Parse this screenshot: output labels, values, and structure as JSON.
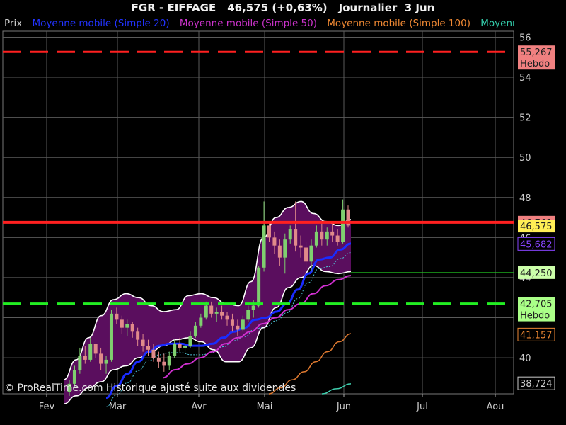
{
  "header": {
    "symbol": "FGR - EIFFAGE",
    "price_change": "46,575 (+0,63%)",
    "period": "Journalier  3 Jun"
  },
  "legend": [
    {
      "label": "Prix",
      "color": "#cccccc"
    },
    {
      "label": "Moyenne mobile (Simple 20)",
      "color": "#2233ff"
    },
    {
      "label": "Moyenne mobile (Simple 50)",
      "color": "#cc33cc"
    },
    {
      "label": "Moyenne mobile (Simple 100)",
      "color": "#ee8833"
    },
    {
      "label": "Moyenne mobile",
      "color": "#33ccaa"
    }
  ],
  "copyright": "© ProRealTime.com Historique ajusté suite aux dividendes",
  "colors": {
    "background": "#000000",
    "grid": "#5a5a5a",
    "band_fill": "#5a0e5e",
    "band_edge": "#ffffff",
    "up_candle": "#7fcf6f",
    "down_candle": "#e08a8a",
    "resistance": "#ff2020",
    "support": "#22ee22"
  },
  "chart_data": {
    "type": "candlestick",
    "x_ticks": [
      "Fev",
      "Mar",
      "Avr",
      "Mai",
      "Jun",
      "Jul",
      "Aou"
    ],
    "y_ticks": [
      40,
      42,
      44,
      46,
      48,
      50,
      52,
      54,
      56
    ],
    "ylim": [
      38.2,
      56.3
    ],
    "grid": true,
    "candles": [
      [
        38.3,
        38.9,
        38.1,
        38.7
      ],
      [
        38.7,
        39.6,
        38.6,
        39.4
      ],
      [
        39.4,
        40.5,
        39.2,
        40.1
      ],
      [
        40.1,
        40.6,
        39.7,
        39.9
      ],
      [
        39.9,
        41.0,
        39.8,
        40.7
      ],
      [
        40.7,
        40.6,
        40.0,
        40.2
      ],
      [
        40.2,
        40.5,
        39.4,
        39.7
      ],
      [
        39.7,
        40.1,
        39.2,
        39.9
      ],
      [
        39.9,
        42.4,
        39.8,
        42.2
      ],
      [
        42.2,
        42.5,
        41.7,
        41.9
      ],
      [
        41.9,
        42.1,
        41.2,
        41.5
      ],
      [
        41.5,
        41.9,
        41.1,
        41.7
      ],
      [
        41.7,
        41.8,
        41.0,
        41.3
      ],
      [
        41.3,
        41.5,
        40.6,
        40.9
      ],
      [
        40.9,
        41.2,
        40.3,
        40.6
      ],
      [
        40.6,
        40.9,
        40.1,
        40.4
      ],
      [
        40.4,
        40.7,
        39.8,
        40.0
      ],
      [
        40.0,
        40.3,
        39.5,
        39.8
      ],
      [
        39.8,
        40.2,
        39.3,
        39.6
      ],
      [
        39.6,
        40.3,
        39.4,
        40.1
      ],
      [
        40.1,
        40.9,
        40.0,
        40.7
      ],
      [
        40.7,
        41.0,
        40.3,
        40.5
      ],
      [
        40.5,
        40.8,
        40.2,
        40.6
      ],
      [
        40.6,
        41.3,
        40.5,
        41.1
      ],
      [
        41.1,
        41.8,
        41.0,
        41.6
      ],
      [
        41.6,
        42.2,
        41.5,
        42.0
      ],
      [
        42.0,
        42.8,
        41.9,
        42.6
      ],
      [
        42.6,
        42.8,
        42.0,
        42.2
      ],
      [
        42.2,
        42.5,
        41.8,
        42.3
      ],
      [
        42.3,
        42.6,
        41.9,
        42.1
      ],
      [
        42.1,
        42.3,
        41.6,
        41.9
      ],
      [
        41.9,
        42.2,
        41.3,
        41.6
      ],
      [
        41.6,
        41.9,
        41.1,
        41.4
      ],
      [
        41.4,
        42.1,
        41.3,
        41.9
      ],
      [
        41.9,
        42.6,
        41.8,
        42.4
      ],
      [
        42.4,
        42.9,
        42.0,
        42.6
      ],
      [
        42.6,
        44.6,
        42.5,
        44.5
      ],
      [
        44.5,
        47.8,
        44.3,
        46.6
      ],
      [
        46.6,
        46.8,
        45.8,
        46.0
      ],
      [
        46.0,
        46.3,
        45.2,
        45.6
      ],
      [
        45.6,
        45.9,
        44.6,
        45.0
      ],
      [
        45.0,
        46.2,
        44.2,
        45.9
      ],
      [
        45.9,
        46.6,
        45.7,
        46.4
      ],
      [
        46.4,
        47.8,
        45.3,
        45.6
      ],
      [
        45.6,
        46.1,
        45.0,
        45.5
      ],
      [
        45.5,
        45.8,
        44.5,
        44.8
      ],
      [
        44.8,
        45.9,
        44.3,
        45.6
      ],
      [
        45.6,
        46.6,
        45.5,
        46.3
      ],
      [
        46.3,
        46.8,
        45.6,
        45.9
      ],
      [
        45.9,
        46.5,
        45.6,
        46.3
      ],
      [
        46.3,
        46.7,
        45.8,
        46.1
      ],
      [
        46.1,
        46.4,
        45.6,
        45.8
      ],
      [
        45.8,
        47.9,
        45.7,
        47.4
      ],
      [
        47.4,
        47.6,
        46.5,
        46.6
      ]
    ],
    "levels": [
      {
        "value": 55.267,
        "label": "55,267",
        "sub": "Hebdo",
        "style": "dashed",
        "color": "#ff2020"
      },
      {
        "value": 46.761,
        "label": "46,761",
        "style": "solid",
        "color": "#ff2020"
      },
      {
        "value": 44.25,
        "label": "44,250",
        "style": "thin",
        "color": "#22cc22"
      },
      {
        "value": 42.705,
        "label": "42,705",
        "sub": "Hebdo",
        "style": "dashed",
        "color": "#22ee22"
      }
    ],
    "price_labels": [
      {
        "value": 55.267,
        "text": "55,267",
        "bg": "#f08080",
        "fg": "#202020",
        "sub": "Hebdo"
      },
      {
        "value": 46.761,
        "text": "46,761",
        "bg": "#f08080",
        "fg": "#202020"
      },
      {
        "value": 46.575,
        "text": "46,575",
        "bg": "#ffee55",
        "fg": "#202020"
      },
      {
        "value": 45.682,
        "text": "45,682",
        "bg": "#000000",
        "fg": "#8844ff",
        "border": "#8844ff"
      },
      {
        "value": 44.25,
        "text": "44,250",
        "bg": "#ccffaa",
        "fg": "#202020"
      },
      {
        "value": 42.705,
        "text": "42,705",
        "bg": "#aaff88",
        "fg": "#202020",
        "sub": "Hebdo"
      },
      {
        "value": 41.157,
        "text": "41,157",
        "bg": "#000000",
        "fg": "#ee8833",
        "border": "#ee8833"
      },
      {
        "value": 38.724,
        "text": "38,724",
        "bg": "#000000",
        "fg": "#cccccc",
        "border": "#cccccc"
      }
    ],
    "ma20": [
      38.0,
      38.6,
      39.2,
      39.8,
      40.3,
      40.6,
      40.7,
      40.7,
      40.6,
      40.6,
      40.7,
      41.0,
      41.3,
      41.5,
      41.9,
      42.0,
      42.3,
      42.7,
      43.4,
      44.2,
      44.9,
      45.0,
      45.4,
      45.7
    ],
    "ma50": [
      39.0,
      39.4,
      39.7,
      40.0,
      40.3,
      40.7,
      41.0,
      41.3,
      41.7,
      42.0,
      42.4,
      42.7,
      43.2,
      43.6,
      43.9,
      44.1
    ],
    "ma100": [
      38.2,
      38.5,
      38.9,
      39.3,
      39.8,
      40.3,
      40.8,
      41.2
    ],
    "ma200": [
      38.2,
      38.45,
      38.7
    ],
    "bollinger_upper": [
      38.9,
      39.9,
      41.0,
      42.1,
      42.9,
      43.2,
      43.0,
      42.6,
      42.3,
      42.4,
      43.1,
      43.2,
      43.0,
      42.7,
      42.6,
      43.8,
      46.0,
      47.0,
      47.5,
      47.8,
      47.2,
      46.8,
      46.6,
      46.9
    ],
    "bollinger_lower": [
      37.7,
      38.1,
      38.5,
      38.8,
      39.4,
      39.6,
      40.0,
      40.3,
      40.6,
      40.9,
      41.0,
      40.8,
      40.4,
      39.8,
      39.8,
      40.5,
      41.5,
      42.5,
      43.5,
      44.0,
      44.6,
      44.3,
      44.2,
      44.3
    ]
  }
}
